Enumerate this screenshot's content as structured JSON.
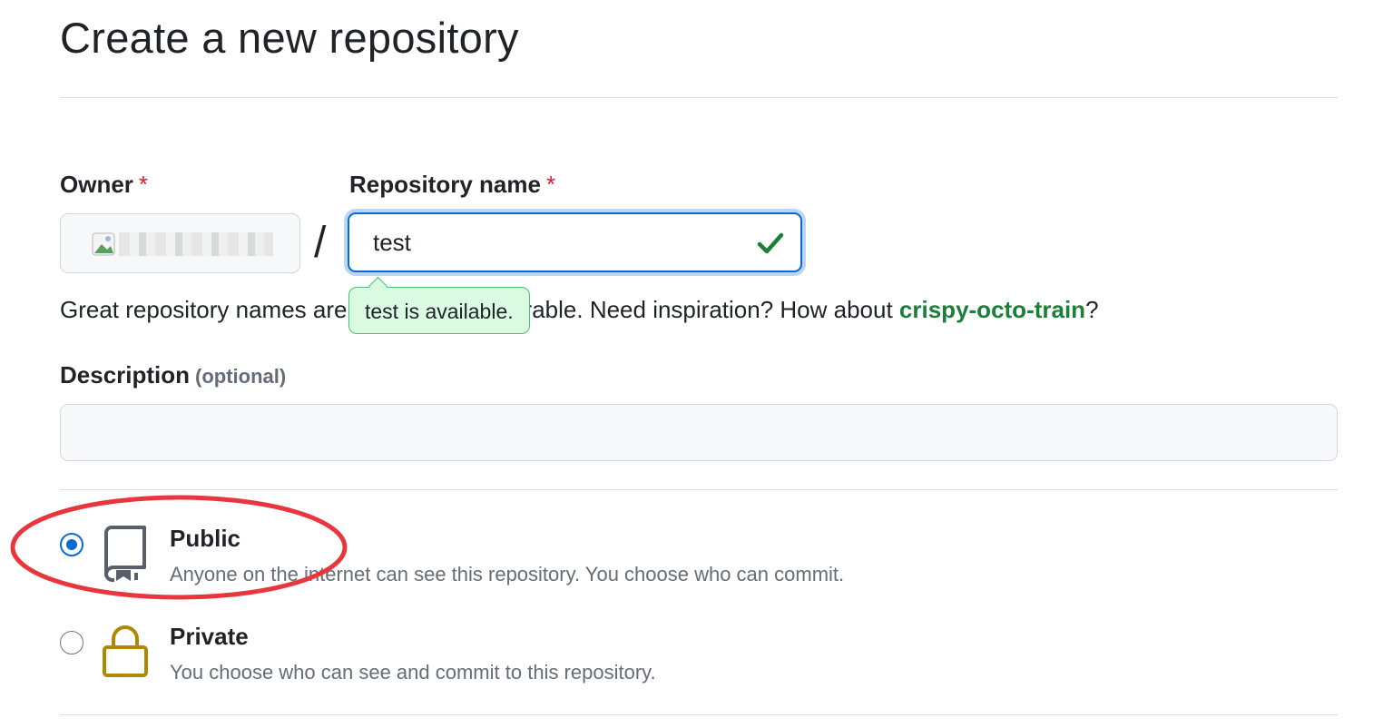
{
  "page": {
    "title": "Create a new repository"
  },
  "owner": {
    "label": "Owner",
    "required_mark": "*"
  },
  "repo": {
    "label": "Repository name",
    "required_mark": "*",
    "separator": "/",
    "value": "test",
    "availability": "test is available."
  },
  "hint": {
    "text_before": "Great repository names are short and memorable. Need inspiration? How about ",
    "suggestion": "crispy-octo-train",
    "text_after": "?"
  },
  "description": {
    "label": "Description",
    "optional": "(optional)",
    "value": ""
  },
  "visibility": {
    "options": [
      {
        "title": "Public",
        "desc": "Anyone on the internet can see this repository. You choose who can commit.",
        "checked": true,
        "icon": "repo-icon"
      },
      {
        "title": "Private",
        "desc": "You choose who can see and commit to this repository.",
        "checked": false,
        "icon": "lock-icon"
      }
    ]
  },
  "colors": {
    "accent": "#0969da",
    "success": "#1a7f37",
    "annotation": "#e8363c",
    "lock": "#b08800"
  }
}
